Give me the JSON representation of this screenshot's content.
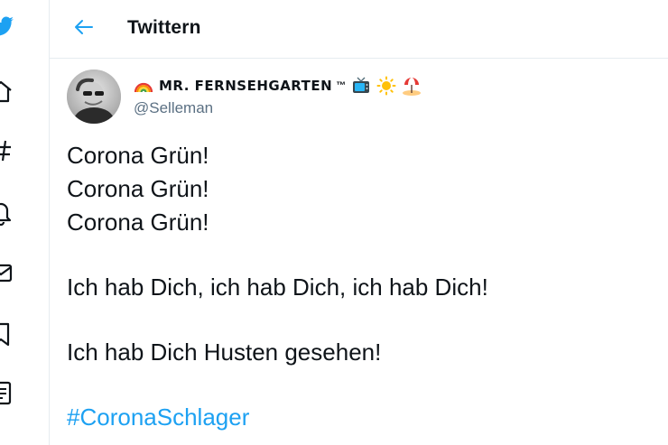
{
  "header": {
    "title": "Twittern"
  },
  "tweet": {
    "display_name": "MR. FERNSEHGARTEN",
    "trademark": "™",
    "handle": "@Selleman",
    "lines_block1": [
      "Corona Grün!",
      "Corona Grün!",
      "Corona Grün!"
    ],
    "line_block2": "Ich hab Dich, ich hab Dich, ich hab Dich!",
    "line_block3": "Ich hab Dich Husten gesehen!",
    "hashtag": "#CoronaSchlager"
  },
  "icons": {
    "nav": [
      "twitter-bird-icon",
      "home-icon",
      "hashtag-icon",
      "bell-icon",
      "mail-icon",
      "bookmark-icon",
      "list-icon"
    ],
    "name_emojis": [
      "rainbow-icon",
      "tv-icon",
      "sun-icon",
      "beach-umbrella-icon"
    ],
    "back": "back-arrow-icon"
  },
  "colors": {
    "accent": "#1da1f2",
    "text": "#0f1419",
    "secondary": "#5b7083",
    "border": "#e6ecf0"
  }
}
